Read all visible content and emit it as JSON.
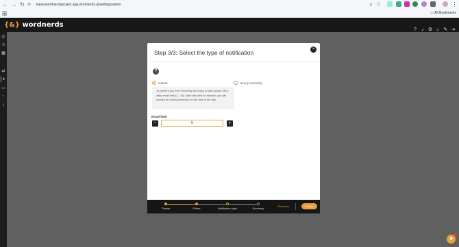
{
  "browser": {
    "url": "katieswordnerdsproject.app.wordnerds.ai/settings/alerts",
    "bookmarks_label": "All Bookmarks"
  },
  "app": {
    "logo_brace": "{&}",
    "logo_text": "wordnerds"
  },
  "modal": {
    "title": "Step 3/3: Select the type of notification",
    "close_icon": "×",
    "help_icon": "?",
    "options": [
      {
        "label": "Instant",
        "selected": true
      },
      {
        "label": "Hourly summary",
        "selected": false
      }
    ],
    "info_text": "To prevent you from receiving too many emails please set a daily email limit (1 - 50). After this limit is reached, you will receive an hourly summary for the rest of the day.",
    "email_limit_label": "Email limit",
    "email_limit_value": "5",
    "minus": "−",
    "plus": "+"
  },
  "stepper": {
    "steps": [
      "Theme",
      "Filters",
      "Notification type",
      "Summary"
    ],
    "current_step": 3,
    "previous_label": "Previous",
    "finish_label": "Finish"
  },
  "colors": {
    "accent": "#e8a13a",
    "dark": "#181818"
  }
}
